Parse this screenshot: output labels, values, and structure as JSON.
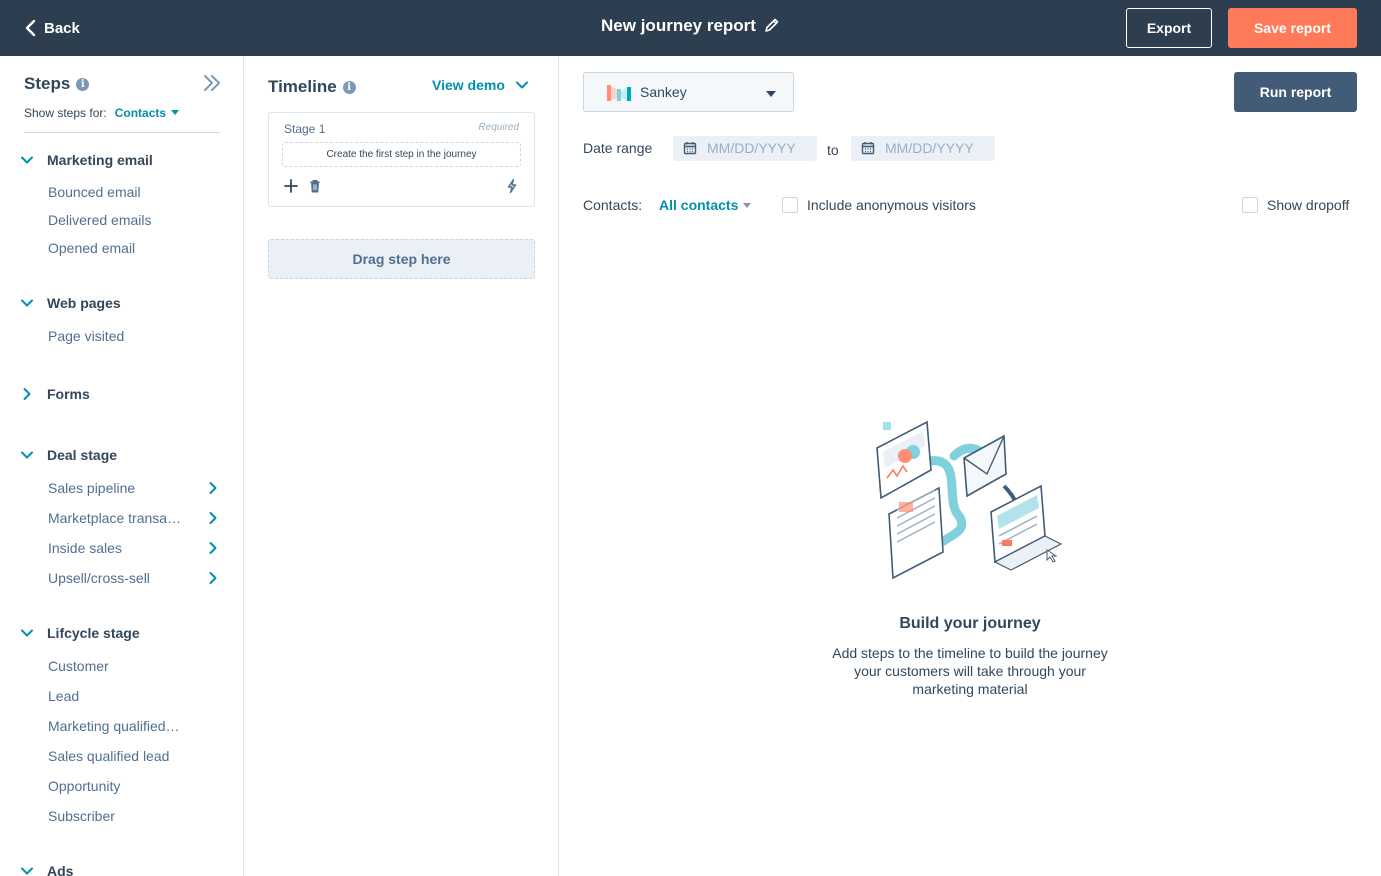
{
  "header": {
    "back_label": "Back",
    "title": "New journey report",
    "export_label": "Export",
    "save_label": "Save report"
  },
  "steps": {
    "title": "Steps",
    "show_for_label": "Show steps for:",
    "show_for_value": "Contacts",
    "groups": [
      {
        "label": "Marketing email",
        "expanded": true,
        "items": [
          {
            "label": "Bounced email"
          },
          {
            "label": "Delivered emails"
          },
          {
            "label": "Opened email"
          }
        ]
      },
      {
        "label": "Web pages",
        "expanded": true,
        "items": [
          {
            "label": "Page visited"
          }
        ]
      },
      {
        "label": "Forms",
        "expanded": false,
        "items": []
      },
      {
        "label": "Deal stage",
        "expanded": true,
        "items": [
          {
            "label": "Sales pipeline",
            "submenu": true
          },
          {
            "label": "Marketplace transa…",
            "submenu": true
          },
          {
            "label": "Inside sales",
            "submenu": true
          },
          {
            "label": "Upsell/cross-sell",
            "submenu": true
          }
        ]
      },
      {
        "label": "Lifcycle stage",
        "expanded": true,
        "items": [
          {
            "label": "Customer"
          },
          {
            "label": "Lead"
          },
          {
            "label": "Marketing qualified…"
          },
          {
            "label": "Sales qualified lead"
          },
          {
            "label": "Opportunity"
          },
          {
            "label": "Subscriber"
          }
        ]
      },
      {
        "label": "Ads",
        "expanded": true,
        "items": []
      }
    ]
  },
  "timeline": {
    "title": "Timeline",
    "view_demo_label": "View demo",
    "stage_label": "Stage 1",
    "required_label": "Required",
    "first_step_label": "Create the first step in the journey",
    "drag_label": "Drag step here"
  },
  "main": {
    "chart_type": "Sankey",
    "run_label": "Run report",
    "date_range_label": "Date range",
    "date_from_placeholder": "MM/DD/YYYY",
    "date_to_placeholder": "MM/DD/YYYY",
    "to_label": "to",
    "contacts_label": "Contacts:",
    "contacts_value": "All contacts",
    "include_anonymous_label": "Include anonymous visitors",
    "include_anonymous_checked": false,
    "show_dropoff_label": "Show dropoff",
    "show_dropoff_checked": false,
    "empty_title": "Build your journey",
    "empty_desc": "Add steps to the timeline to build the journey your customers will take through your marketing material"
  },
  "colors": {
    "header_bg": "#2d3e50",
    "accent_orange": "#ff7a59",
    "link_teal": "#0091ae",
    "run_btn": "#425b76",
    "text": "#33475b"
  }
}
